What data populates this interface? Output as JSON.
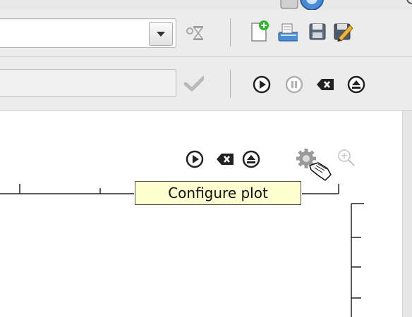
{
  "tooltip": {
    "text": "Configure plot"
  },
  "toolbar1": {
    "combo_value": "",
    "icons": [
      "dropdown-arrow-icon",
      "hourglass-icon",
      "new-document-icon",
      "open-icon",
      "save-icon",
      "edit-icon"
    ]
  },
  "toolbar2": {
    "field_value": "",
    "icons": [
      "checkmark-icon",
      "play-icon",
      "pause-icon",
      "clear-icon",
      "eject-icon"
    ]
  },
  "plot_toolbar": {
    "icons": [
      "play-icon",
      "clear-icon",
      "eject-icon",
      "gear-icon",
      "zoom-in-icon"
    ]
  },
  "colors": {
    "window_bg": "#ededed",
    "plot_bg": "#ffffff",
    "tooltip_bg": "#ffffcf",
    "save_icon": "#5a6a7a",
    "new_doc_accent": "#2fb52f"
  }
}
